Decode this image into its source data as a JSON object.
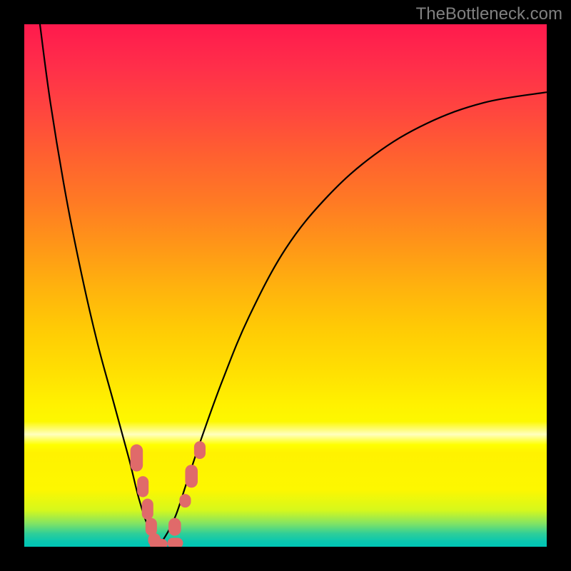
{
  "watermark": "TheBottleneck.com",
  "chart_data": {
    "type": "line",
    "title": "",
    "xlabel": "",
    "ylabel": "",
    "xlim": [
      0,
      100
    ],
    "ylim": [
      0,
      100
    ],
    "series": [
      {
        "name": "bottleneck-curve",
        "x": [
          3,
          5,
          8,
          11,
          14,
          17,
          20,
          22,
          24,
          25.5,
          27,
          29,
          31,
          34,
          38,
          43,
          50,
          58,
          67,
          77,
          88,
          100
        ],
        "y": [
          100,
          85,
          67,
          52,
          39,
          28,
          17,
          9,
          3,
          0.5,
          2,
          6,
          12,
          21,
          32,
          44,
          57,
          67,
          75,
          81,
          85,
          87
        ]
      }
    ],
    "markers": [
      {
        "name": "cluster-left-top",
        "x": 21.5,
        "y": 17,
        "w": 2.4,
        "h": 5.2
      },
      {
        "name": "cluster-left-upper",
        "x": 22.7,
        "y": 11.5,
        "w": 2.2,
        "h": 4.0
      },
      {
        "name": "cluster-left-mid",
        "x": 23.6,
        "y": 7.2,
        "w": 2.2,
        "h": 4.0
      },
      {
        "name": "cluster-left-low1",
        "x": 24.3,
        "y": 3.8,
        "w": 2.2,
        "h": 3.4
      },
      {
        "name": "cluster-left-low2",
        "x": 24.9,
        "y": 1.3,
        "w": 2.4,
        "h": 2.6
      },
      {
        "name": "cluster-bottom-1",
        "x": 25.7,
        "y": 0.5,
        "w": 3.4,
        "h": 2.0
      },
      {
        "name": "cluster-bottom-2",
        "x": 28.9,
        "y": 0.7,
        "w": 3.0,
        "h": 2.0
      },
      {
        "name": "cluster-right-low",
        "x": 28.8,
        "y": 3.8,
        "w": 2.4,
        "h": 3.4
      },
      {
        "name": "cluster-right-mid",
        "x": 30.8,
        "y": 8.8,
        "w": 2.2,
        "h": 2.6
      },
      {
        "name": "cluster-right-upper",
        "x": 32.0,
        "y": 13.5,
        "w": 2.4,
        "h": 4.4
      },
      {
        "name": "cluster-right-top",
        "x": 33.6,
        "y": 18.5,
        "w": 2.2,
        "h": 3.4
      }
    ],
    "colors": {
      "curve": "#000000",
      "marker": "#e06a6a"
    }
  }
}
